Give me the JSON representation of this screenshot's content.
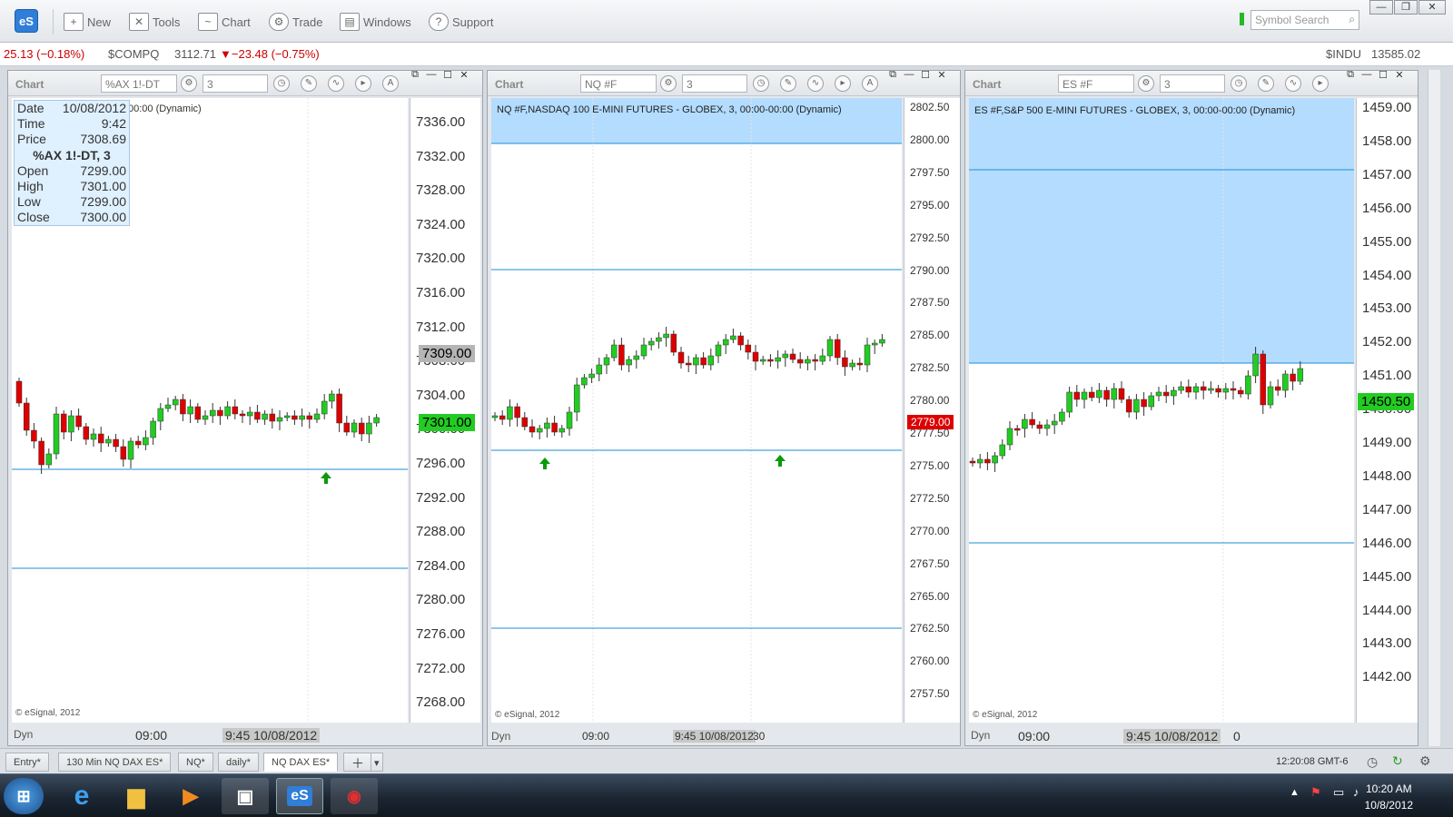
{
  "toolbar": {
    "logo": "eS",
    "buttons": [
      {
        "label": "New",
        "icon": "new-icon"
      },
      {
        "label": "Tools",
        "icon": "tools-icon"
      },
      {
        "label": "Chart",
        "icon": "chart-icon"
      },
      {
        "label": "Trade",
        "icon": "trade-icon"
      },
      {
        "label": "Windows",
        "icon": "windows-icon"
      },
      {
        "label": "Support",
        "icon": "support-icon"
      }
    ],
    "search_placeholder": "Symbol Search"
  },
  "ticker": {
    "left_change": "25.13 (−0.18%)",
    "compq_symbol": "$COMPQ",
    "compq_price": "3112.71",
    "compq_change": "▼−23.48 (−0.75%)",
    "indu_symbol": "$INDU",
    "indu_price": "13585.02"
  },
  "charts": [
    {
      "label": "Chart",
      "symbol": "%AX 1!-DT",
      "interval": "3",
      "title_text": "00:00 (Dynamic)",
      "price_tag": "7309.00",
      "last_tag": "7301.00",
      "axis": [
        "7336.00",
        "7332.00",
        "7328.00",
        "7324.00",
        "7320.00",
        "7316.00",
        "7312.00",
        "7308.00",
        "7304.00",
        "7300.00",
        "7296.00",
        "7292.00",
        "7288.00",
        "7284.00",
        "7280.00",
        "7276.00",
        "7272.00",
        "7268.00"
      ],
      "time_label": "09:00",
      "time_cursor": "9:45 10/08/2012",
      "copyright": "© eSignal, 2012",
      "dyn": "Dyn"
    },
    {
      "label": "Chart",
      "symbol": "NQ #F",
      "interval": "3",
      "title_text": "NQ #F,NASDAQ 100 E-MINI FUTURES - GLOBEX, 3, 00:00-00:00 (Dynamic)",
      "last_tag": "2779.00",
      "axis": [
        "2802.50",
        "2800.00",
        "2797.50",
        "2795.00",
        "2792.50",
        "2790.00",
        "2787.50",
        "2785.00",
        "2782.50",
        "2780.00",
        "2777.50",
        "2775.00",
        "2772.50",
        "2770.00",
        "2767.50",
        "2765.00",
        "2762.50",
        "2760.00",
        "2757.50"
      ],
      "time_label": "09:00",
      "time_cursor": "9:45 10/08/2012",
      "time_extra": "30",
      "copyright": "© eSignal, 2012",
      "dyn": "Dyn"
    },
    {
      "label": "Chart",
      "symbol": "ES #F",
      "interval": "3",
      "title_text": "ES #F,S&P 500 E-MINI FUTURES - GLOBEX, 3, 00:00-00:00 (Dynamic)",
      "last_tag": "1450.50",
      "axis": [
        "1459.00",
        "1458.00",
        "1457.00",
        "1456.00",
        "1455.00",
        "1454.00",
        "1453.00",
        "1452.00",
        "1451.00",
        "1450.00",
        "1449.00",
        "1448.00",
        "1447.00",
        "1446.00",
        "1445.00",
        "1444.00",
        "1443.00",
        "1442.00"
      ],
      "time_label": "09:00",
      "time_cursor": "9:45 10/08/2012",
      "time_extra": "0",
      "copyright": "© eSignal, 2012",
      "dyn": "Dyn"
    }
  ],
  "ohlc": {
    "date_label": "Date",
    "date": "10/08/2012",
    "time_label": "Time",
    "time": "9:42",
    "price_label": "Price",
    "price": "7308.69",
    "symbol": "%AX 1!-DT, 3",
    "open_label": "Open",
    "open": "7299.00",
    "high_label": "High",
    "high": "7301.00",
    "low_label": "Low",
    "low": "7299.00",
    "close_label": "Close",
    "close": "7300.00"
  },
  "tabs": [
    "Entry*",
    "130 Min NQ DAX ES*",
    "NQ*",
    "daily*",
    "NQ DAX ES*"
  ],
  "active_tab": "NQ DAX ES*",
  "status": {
    "server_time": "12:20:08 GMT-6"
  },
  "taskbar": {
    "time": "10:20 AM",
    "date": "10/8/2012"
  },
  "colors": {
    "up": "#22cc22",
    "down": "#dd0000",
    "highlight": "#b3dcff",
    "hline": "#1b8fd6"
  }
}
